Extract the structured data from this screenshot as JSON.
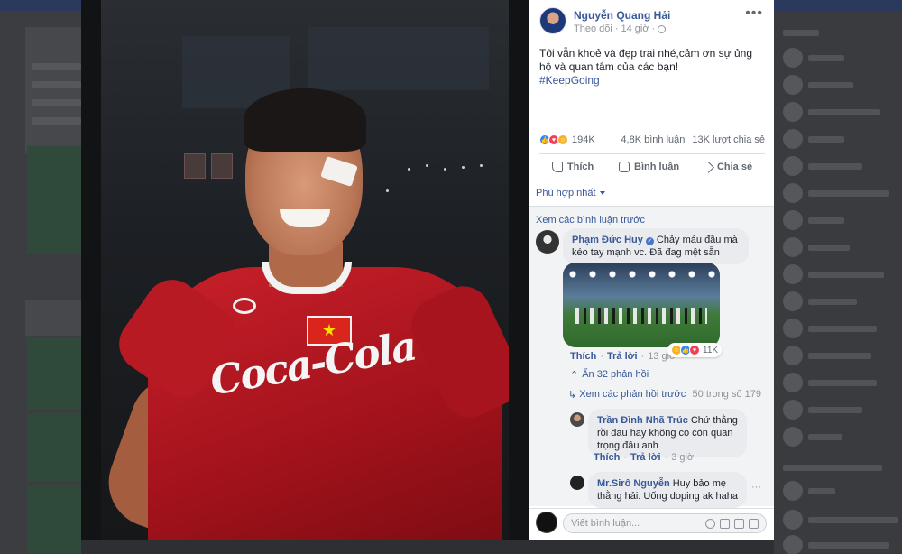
{
  "post": {
    "author": "Nguyễn Quang Hải",
    "follow_label": "Theo dõi",
    "separator": "·",
    "time": "14 giờ",
    "caption": "Tôi vẫn khoẻ và đẹp trai nhé,cảm ơn sự ủng hộ và quan tâm của các bạn!",
    "hashtag": "#KeepGoing",
    "more_label": "•••"
  },
  "stats": {
    "reaction_count": "194K",
    "comments": "4,8K bình luận",
    "shares": "13K lượt chia sẻ",
    "reaction_icons": [
      "like-icon",
      "love-icon",
      "haha-icon"
    ]
  },
  "actions": {
    "like": "Thích",
    "comment": "Bình luận",
    "share": "Chia sẻ"
  },
  "sort_label": "Phù hợp nhất",
  "comments": {
    "see_previous": "Xem các bình luận trước",
    "main": {
      "name": "Phạm Đức Huy",
      "text": "Chảy máu đầu mà kéo tay mạnh vc. Đã đag mệt sẵn",
      "like": "Thích",
      "reply": "Trả lời",
      "time": "13 giờ",
      "reaction_count": "11K",
      "dot": "·"
    },
    "hide_replies": "Ẩn 32 phản hồi",
    "view_previous_replies": "Xem các phản hồi trước",
    "replies_count": "50 trong số 179",
    "reply1": {
      "name": "Trần Đình Nhã Trúc",
      "text": "Chứ thằng rồi đau hay không có còn quan trọng đâu anh",
      "like": "Thích",
      "reply": "Trả lời",
      "time": "3 giờ",
      "dot": "·"
    },
    "reply2": {
      "name": "Mr.Sirô Nguyễn",
      "text": "Huy bảo mẹ thằng hải. Uống doping ak haha",
      "more": "···"
    }
  },
  "composer": {
    "placeholder": "Viết bình luận..."
  },
  "photo": {
    "flag_star": "★",
    "shirt_text": "Coca-Cola"
  },
  "colors": {
    "link_blue": "#385898",
    "like_blue": "#2d88ff",
    "love_red": "#f33e58",
    "haha_yellow": "#f7b125",
    "jersey_red": "#c8202a"
  }
}
